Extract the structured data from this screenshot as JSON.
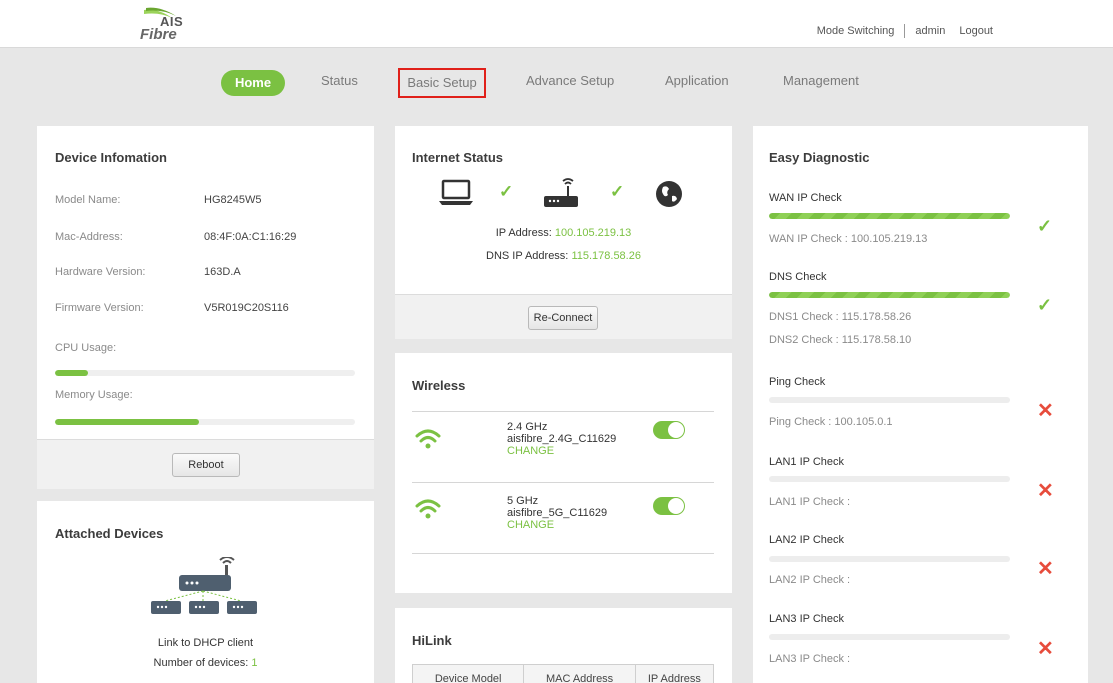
{
  "brand": {
    "top": "AIS",
    "bottom": "Fibre",
    "accent": "#7bc142"
  },
  "header": {
    "mode_switching": "Mode Switching",
    "user": "admin",
    "logout": "Logout"
  },
  "nav": {
    "home": "Home",
    "status": "Status",
    "basic_setup": "Basic Setup",
    "advance_setup": "Advance Setup",
    "application": "Application",
    "management": "Management"
  },
  "device": {
    "title": "Device Infomation",
    "model_label": "Model Name:",
    "model_value": "HG8245W5",
    "mac_label": "Mac-Address:",
    "mac_value": "08:4F:0A:C1:16:29",
    "hw_label": "Hardware Version:",
    "hw_value": "163D.A",
    "fw_label": "Firmware Version:",
    "fw_value": "V5R019C20S116",
    "cpu_label": "CPU Usage:",
    "cpu_usage": 0.11,
    "mem_label": "Memory Usage:",
    "mem_usage": 0.48,
    "reboot": "Reboot"
  },
  "attached": {
    "title": "Attached Devices",
    "link_text": "Link to DHCP client",
    "count_label": "Number of devices:",
    "count": "1"
  },
  "internet": {
    "title": "Internet Status",
    "ip_label": "IP Address:",
    "ip": "100.105.219.13",
    "dns_label": "DNS IP Address:",
    "dns": "115.178.58.26",
    "reconnect": "Re-Connect"
  },
  "wireless": {
    "title": "Wireless",
    "bands": [
      {
        "band": "2.4 GHz",
        "ssid": "aisfibre_2.4G_C11629",
        "change": "CHANGE",
        "enabled": true
      },
      {
        "band": "5 GHz",
        "ssid": "aisfibre_5G_C11629",
        "change": "CHANGE",
        "enabled": true
      }
    ]
  },
  "hilink": {
    "title": "HiLink",
    "columns": [
      "Device Model",
      "MAC Address",
      "IP Address"
    ]
  },
  "diagnostic": {
    "title": "Easy Diagnostic",
    "wan": {
      "label": "WAN IP Check",
      "detail": "WAN IP Check : 100.105.219.13",
      "progress": 1.0,
      "ok": true
    },
    "dns": {
      "label": "DNS Check",
      "detail1": "DNS1 Check : 115.178.58.26",
      "detail2": "DNS2 Check : 115.178.58.10",
      "progress": 1.0,
      "ok": true
    },
    "ping": {
      "label": "Ping Check",
      "detail": "Ping Check : 100.105.0.1",
      "progress": 0,
      "ok": false
    },
    "lan1": {
      "label": "LAN1 IP Check",
      "detail": "LAN1 IP Check :",
      "progress": 0,
      "ok": false
    },
    "lan2": {
      "label": "LAN2 IP Check",
      "detail": "LAN2 IP Check :",
      "progress": 0,
      "ok": false
    },
    "lan3": {
      "label": "LAN3 IP Check",
      "detail": "LAN3 IP Check :",
      "progress": 0,
      "ok": false
    },
    "ok_glyph": "✓",
    "fail_glyph": "✕"
  }
}
